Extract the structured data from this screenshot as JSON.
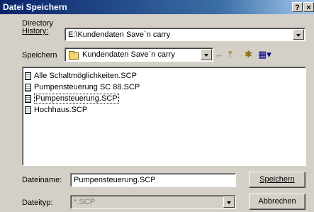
{
  "window": {
    "title": "Datei Speichern",
    "help_label": "?",
    "close_label": "×"
  },
  "history": {
    "label_line1": "Directory",
    "label_line2": "History:",
    "value": "E:\\Kundendaten Save`n carry"
  },
  "save_in": {
    "label": "Speichern",
    "value": "Kundendaten Save`n carry"
  },
  "toolbar": {
    "back_glyph": "←",
    "up_glyph": "⤒",
    "new_folder_glyph": "✱",
    "view_glyph": "▦▾"
  },
  "files": [
    {
      "name": "Alle Schaltmöglichkeiten.SCP"
    },
    {
      "name": "Pumpensteuerung SC 88.SCP"
    },
    {
      "name": "Pumpensteuerung.SCP"
    },
    {
      "name": "Hochhaus.SCP"
    }
  ],
  "filename": {
    "label": "Dateiname:",
    "value": "Pumpensteuerung.SCP"
  },
  "filetype": {
    "label": "Dateityp:",
    "value": "*.SCP"
  },
  "buttons": {
    "save": "Speichern",
    "cancel": "Abbrechen"
  }
}
